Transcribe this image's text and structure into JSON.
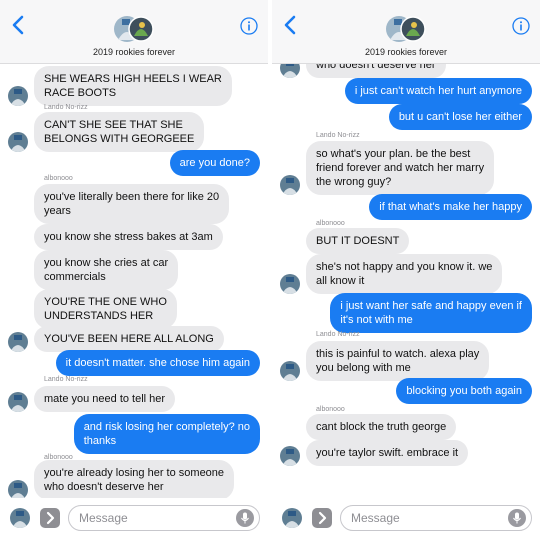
{
  "colors": {
    "accent": "#1a7cf2",
    "incoming": "#e9e9eb",
    "label": "#8e8e93"
  },
  "left": {
    "header": {
      "group_name": "2019 rookies forever",
      "back_icon": "chevron-left-icon",
      "info_icon": "info-icon"
    },
    "messages": [
      {
        "dir": "in",
        "avatar": true,
        "text": "SHE WEARS HIGH HEELS I WEAR\nRACE BOOTS"
      },
      {
        "dir": "sender",
        "text": "Lando No-rizz"
      },
      {
        "dir": "in",
        "avatar": true,
        "text": "CAN'T SHE SEE THAT SHE\nBELONGS WITH GEORGEEE"
      },
      {
        "dir": "out",
        "text": "are you done?"
      },
      {
        "dir": "sender",
        "text": "albonooo"
      },
      {
        "dir": "in",
        "text": "you've literally been there for like 20\nyears"
      },
      {
        "dir": "in",
        "text": "you know she stress bakes at 3am"
      },
      {
        "dir": "in",
        "text": "you know she cries at car\ncommercials"
      },
      {
        "dir": "in",
        "text": "YOU'RE THE ONE WHO\nUNDERSTANDS HER"
      },
      {
        "dir": "in",
        "avatar": true,
        "text": "YOU'VE BEEN HERE ALL ALONG"
      },
      {
        "dir": "out",
        "text": "it doesn't matter. she chose him again"
      },
      {
        "dir": "sender",
        "text": "Lando No-rizz"
      },
      {
        "dir": "in",
        "avatar": true,
        "text": "mate you need to tell her"
      },
      {
        "dir": "out",
        "text": "and risk losing her completely? no\nthanks"
      },
      {
        "dir": "sender",
        "text": "albonooo"
      },
      {
        "dir": "in",
        "avatar": true,
        "text": "you're already losing her to someone\nwho doesn't deserve her"
      }
    ],
    "input": {
      "placeholder": "Message"
    }
  },
  "right": {
    "header": {
      "group_name": "2019 rookies forever",
      "back_icon": "chevron-left-icon",
      "info_icon": "info-icon"
    },
    "messages": [
      {
        "dir": "in",
        "avatar": true,
        "text": "who doesn't deserve her"
      },
      {
        "dir": "out",
        "text": "i just can't watch her hurt anymore"
      },
      {
        "dir": "out",
        "text": "but u can't lose her either"
      },
      {
        "dir": "sender",
        "text": "Lando No-rizz"
      },
      {
        "dir": "in",
        "avatar": true,
        "text": "so what's your plan. be the best\nfriend forever and watch her marry\nthe wrong guy?"
      },
      {
        "dir": "out",
        "text": "if that what's make her happy"
      },
      {
        "dir": "sender",
        "text": "albonooo"
      },
      {
        "dir": "in",
        "text": "BUT IT DOESNT"
      },
      {
        "dir": "in",
        "avatar": true,
        "text": "she's not happy and you know it. we\nall know it"
      },
      {
        "dir": "out",
        "text": "i just want her safe and happy even if\nit's not with me"
      },
      {
        "dir": "sender",
        "text": "Lando No-rizz"
      },
      {
        "dir": "in",
        "avatar": true,
        "text": "this is painful to watch. alexa play\nyou belong with me"
      },
      {
        "dir": "out",
        "text": "blocking you both again"
      },
      {
        "dir": "sender",
        "text": "albonooo"
      },
      {
        "dir": "in",
        "text": "cant block the truth george"
      },
      {
        "dir": "in",
        "avatar": true,
        "text": "you're taylor swift. embrace it"
      }
    ],
    "input": {
      "placeholder": "Message"
    }
  }
}
